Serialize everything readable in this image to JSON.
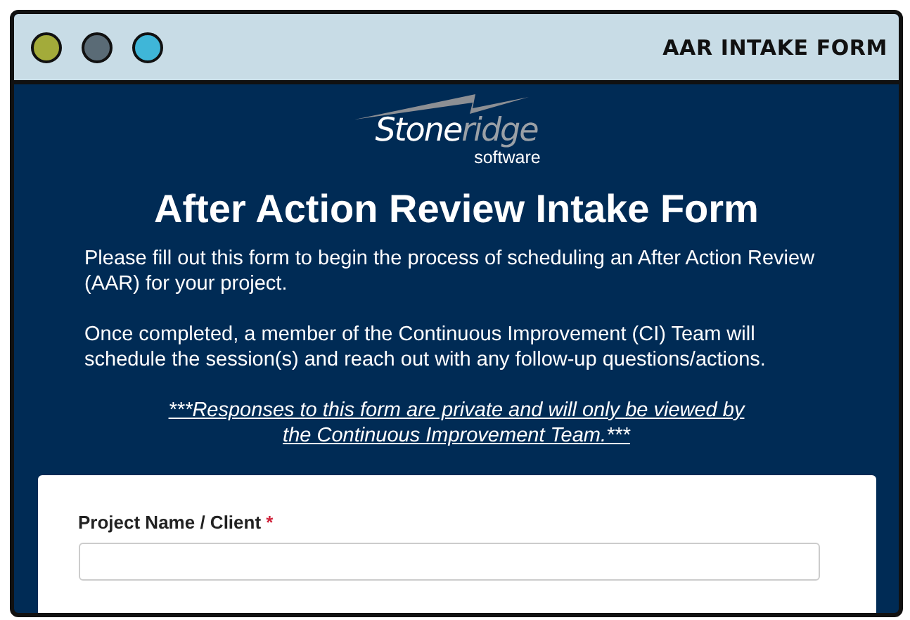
{
  "window": {
    "title": "AAR INTAKE FORM",
    "controls": [
      {
        "color": "#a3ab3a"
      },
      {
        "color": "#5a6b76"
      },
      {
        "color": "#3fb6d8"
      }
    ]
  },
  "logo": {
    "name_start": "Stone",
    "name_end": "ridge",
    "tagline": "software"
  },
  "heading": "After Action Review Intake Form",
  "paragraphs": [
    "Please fill out this form to begin the process of scheduling an After Action Review (AAR) for your project.",
    "Once completed, a member of the Continuous Improvement (CI) Team will schedule the session(s) and reach out with any follow-up questions/actions."
  ],
  "privacy_note": [
    "***Responses to this form are private and will only be viewed by",
    "the Continuous Improvement Team.***"
  ],
  "form": {
    "fields": [
      {
        "label": "Project Name / Client",
        "required": true,
        "required_mark": "*"
      }
    ]
  }
}
